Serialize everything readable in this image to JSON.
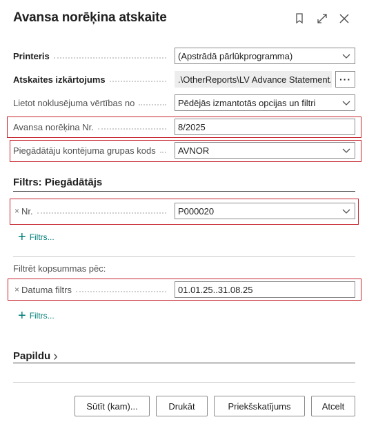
{
  "dialog": {
    "title": "Avansa norēķina atskaite"
  },
  "header_icons": {
    "bookmark": "bookmark-icon",
    "expand": "expand-icon",
    "close": "close-icon"
  },
  "fields": {
    "printer": {
      "label": "Printeris",
      "value": "(Apstrādā pārlūkprogramma)"
    },
    "layout": {
      "label": "Atskaites izkārtojums",
      "value": ".\\OtherReports\\LV Advance Statement...",
      "more": "···"
    },
    "defaults": {
      "label": "Lietot noklusējuma vērtības no",
      "value": "Pēdējās izmantotās opcijas un filtri"
    },
    "advance_no": {
      "label": "Avansa norēķina Nr.",
      "value": "8/2025"
    },
    "vendor_group": {
      "label": "Piegādātāju kontējuma grupas kods",
      "value": "AVNOR"
    }
  },
  "filter_section": {
    "title": "Filtrs: Piegādātājs",
    "nr": {
      "remove": "×",
      "label": "Nr.",
      "value": "P000020"
    },
    "add": {
      "plus": "+",
      "label": "Filtrs..."
    }
  },
  "totals_section": {
    "title": "Filtrēt kopsummas pēc:",
    "date": {
      "remove": "×",
      "label": "Datuma filtrs",
      "value": "01.01.25..31.08.25"
    },
    "add": {
      "plus": "+",
      "label": "Filtrs..."
    }
  },
  "extra": {
    "title": "Papildu",
    "chevron": "›"
  },
  "buttons": {
    "send": "Sūtīt (kam)...",
    "print": "Drukāt",
    "preview": "Priekšskatījums",
    "cancel": "Atcelt"
  },
  "colors": {
    "accent": "#00807a",
    "highlight": "#c4222b"
  }
}
